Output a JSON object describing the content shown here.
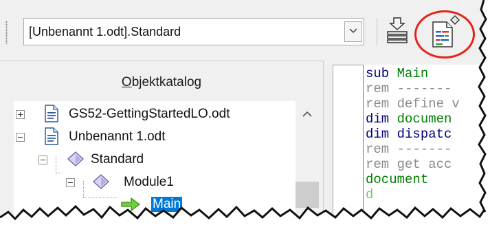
{
  "toolbar": {
    "library_selector": {
      "value": "[Unbenannt 1.odt].Standard"
    }
  },
  "object_catalog": {
    "title_accesskey": "O",
    "title_rest": "bjektkatalog",
    "tree": [
      {
        "label": "GS52-GettingStartedLO.odt",
        "icon": "document-icon",
        "expander": "plus"
      },
      {
        "label": "Unbenannt 1.odt",
        "icon": "document-icon",
        "expander": "minus"
      },
      {
        "label": "Standard",
        "icon": "library-icon",
        "expander": "minus"
      },
      {
        "label": "Module1",
        "icon": "module-icon",
        "expander": "minus"
      },
      {
        "label": "Main",
        "icon": "macro-arrow-icon",
        "selected": true
      }
    ]
  },
  "editor": {
    "lines": [
      {
        "text": "sub Main",
        "kind": "keyword-ident"
      },
      {
        "text": "rem -------",
        "kind": "comment"
      },
      {
        "text": "rem define v",
        "kind": "comment"
      },
      {
        "text": "dim documen",
        "kind": "keyword-ident"
      },
      {
        "text": "dim dispatc",
        "kind": "keyword-ident"
      },
      {
        "text": "rem -------",
        "kind": "comment"
      },
      {
        "text": "rem get acc",
        "kind": "comment"
      },
      {
        "text": "document",
        "kind": "ident"
      }
    ]
  },
  "colors": {
    "highlight_ring": "#e5231b",
    "selection": "#0078d7",
    "keyword": "#000080",
    "identifier": "#008000",
    "comment": "#8a8a8a"
  }
}
